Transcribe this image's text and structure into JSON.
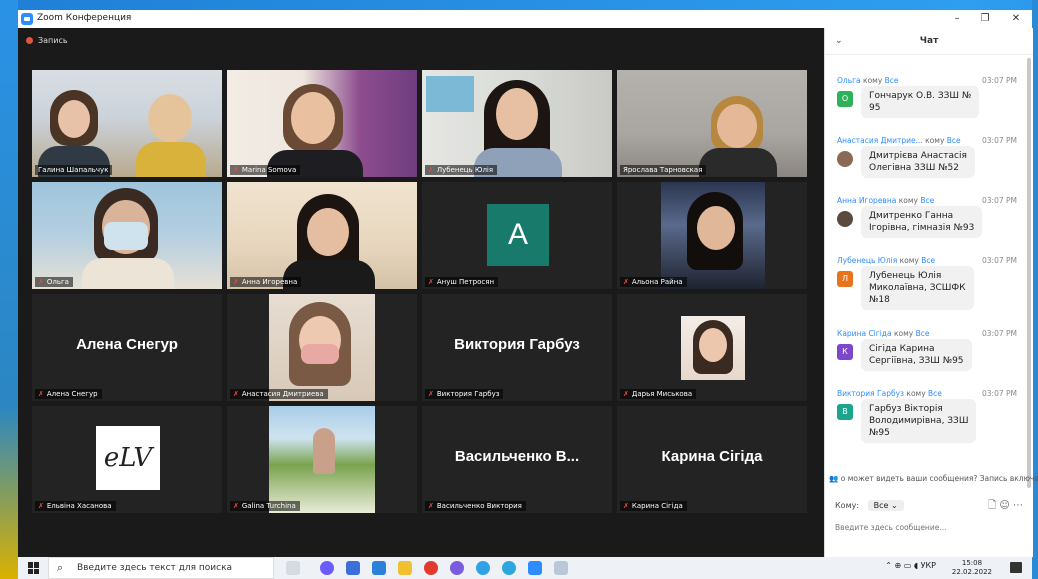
{
  "window": {
    "title": "Zoom Конференция",
    "minimize": "–",
    "maximize": "❐",
    "close": "✕"
  },
  "recording": {
    "label": "Запись"
  },
  "participants": [
    {
      "name": "Галина Шапальчук",
      "kind": "video",
      "active": true
    },
    {
      "name": "Marina Somova",
      "kind": "video"
    },
    {
      "name": "Лубенець Юлія",
      "kind": "video"
    },
    {
      "name": "Ярослава Тарновская",
      "kind": "video"
    },
    {
      "name": "Ольга",
      "kind": "video"
    },
    {
      "name": "Анна Игоревна",
      "kind": "video"
    },
    {
      "name": "Ануш Петросян",
      "kind": "avatar",
      "initial": "A"
    },
    {
      "name": "Альона Райна",
      "kind": "video"
    },
    {
      "name": "Алена Снегур",
      "kind": "text",
      "display": "Алена Снегур"
    },
    {
      "name": "Анастасия Дмитриева",
      "kind": "video"
    },
    {
      "name": "Виктория Гарбуз",
      "kind": "text",
      "display": "Виктория Гарбуз"
    },
    {
      "name": "Дарья Миськова",
      "kind": "video"
    },
    {
      "name": "Ельвіна Хасанова",
      "kind": "logo",
      "logo_text": "eLV"
    },
    {
      "name": "Galina Turchina",
      "kind": "video"
    },
    {
      "name": "Васильченко Виктория",
      "kind": "text",
      "display": "Васильченко В..."
    },
    {
      "name": "Карина Сігіда",
      "kind": "text",
      "display": "Карина Сігіда"
    }
  ],
  "chat": {
    "title": "Чат",
    "messages": [
      {
        "from": "Ольга",
        "to_label": "кому",
        "to": "Все",
        "time": "03:07 PM",
        "initial": "О",
        "color": "#2fb05a",
        "text": [
          "Гончарук О.В. ЗЗШ №",
          "95"
        ]
      },
      {
        "from": "Анастасия Дмитрие...",
        "to_label": "кому",
        "to": "Все",
        "time": "03:07 PM",
        "initial": "",
        "color": "#8a6a55",
        "text": [
          "Дмитрієва Анастасія",
          "Олегівна ЗЗШ №52"
        ]
      },
      {
        "from": "Анна Игоревна",
        "to_label": "кому",
        "to": "Все",
        "time": "03:07 PM",
        "initial": "",
        "color": "#5a4a40",
        "text": [
          "Дмитренко Ганна",
          "Ігорівна, гімназія №93"
        ]
      },
      {
        "from": "Лубенець Юлія",
        "to_label": "кому",
        "to": "Все",
        "time": "03:07 PM",
        "initial": "Л",
        "color": "#e8731c",
        "text": [
          "Лубенець Юлія",
          "Миколаївна, ЗСШФК",
          "№18"
        ]
      },
      {
        "from": "Карина Сігіда",
        "to_label": "кому",
        "to": "Все",
        "time": "03:07 PM",
        "initial": "К",
        "color": "#7b48c9",
        "text": [
          "Сігіда Карина",
          "Сергіївна, ЗЗШ  №95"
        ]
      },
      {
        "from": "Виктория Гарбуз",
        "to_label": "кому",
        "to": "Все",
        "time": "03:07 PM",
        "initial": "В",
        "color": "#1aa58c",
        "text": [
          "Гарбуз Вікторія",
          "Володимирівна, ЗЗШ",
          "№95"
        ]
      }
    ],
    "notice": "о может видеть ваши сообщения? Запись включена",
    "to_label": "Кому:",
    "to_value": "Все",
    "input_placeholder": "Введите здесь сообщение..."
  },
  "taskbar": {
    "search_placeholder": "Введите здесь текст для поиска",
    "lang": "УКР",
    "time": "15:08",
    "date": "22.02.2022"
  }
}
